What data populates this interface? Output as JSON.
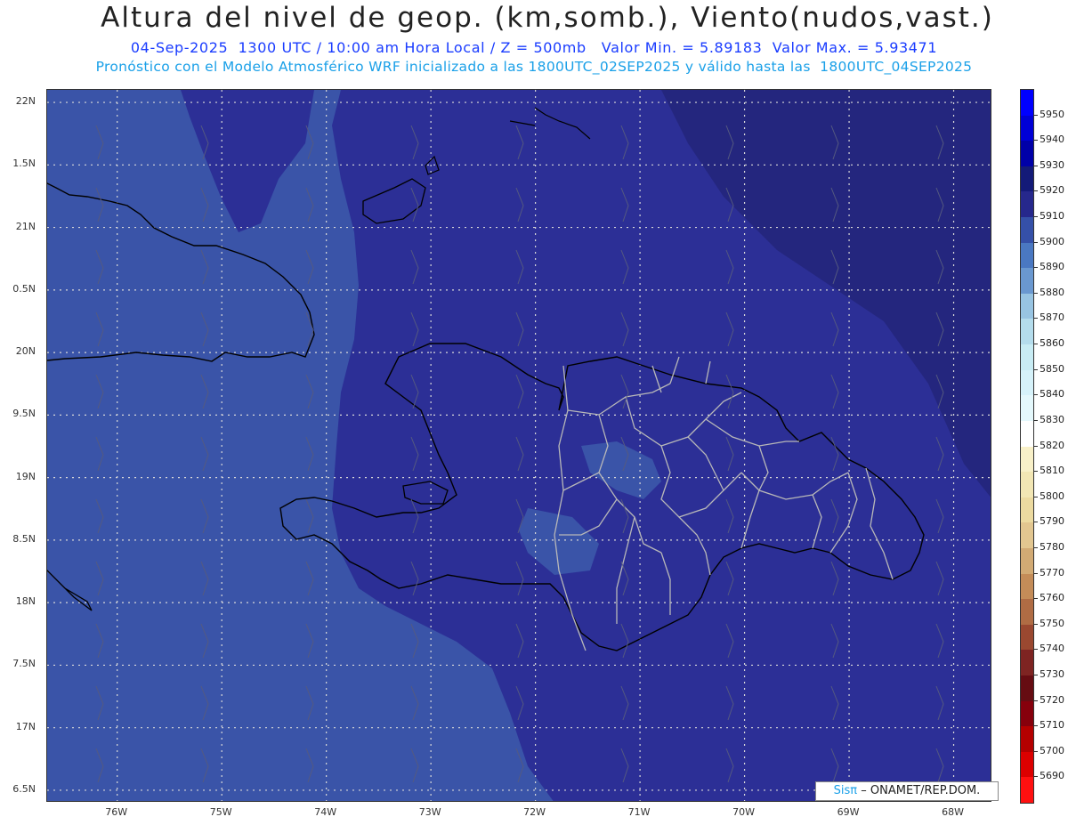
{
  "header": {
    "title": "Altura del nivel de geop. (km,somb.), Viento(nudos,vast.)",
    "subtitle1": "04-Sep-2025  1300 UTC / 10:00 am Hora Local / Z = 500mb   Valor Min. = 5.89183  Valor Max. = 5.93471",
    "subtitle2": "Pronóstico con el Modelo Atmosférico WRF inicializado a las 1800UTC_02SEP2025 y válido hasta las  1800UTC_04SEP2025"
  },
  "map": {
    "lon_range": [
      -76.67,
      -67.63
    ],
    "lat_range": [
      16.4,
      22.1
    ],
    "lat_labels": [
      "22N",
      "1.5N",
      "21N",
      "0.5N",
      "20N",
      "9.5N",
      "19N",
      "8.5N",
      "18N",
      "7.5N",
      "17N",
      "6.5N"
    ],
    "lat_values": [
      22,
      21.5,
      21,
      20.5,
      20,
      19.5,
      19,
      18.5,
      18,
      17.5,
      17,
      16.5
    ],
    "lon_labels": [
      "76W",
      "75W",
      "74W",
      "73W",
      "72W",
      "71W",
      "70W",
      "69W",
      "68W"
    ],
    "lon_values": [
      -76,
      -75,
      -74,
      -73,
      -72,
      -71,
      -70,
      -69,
      -68
    ],
    "colors": {
      "lower": "#3a54a8",
      "mid": "#2c2f96",
      "upper": "#24267e",
      "coast": "#000000",
      "provinces": "#b8b8b8",
      "grid": "#d8d8d8"
    }
  },
  "credit": {
    "sis": "Sisπ",
    "rest": "– ONAMET/REP.DOM."
  },
  "colorbar": {
    "labels": [
      "5950",
      "5940",
      "5930",
      "5920",
      "5910",
      "5900",
      "5890",
      "5880",
      "5870",
      "5860",
      "5850",
      "5840",
      "5830",
      "5820",
      "5810",
      "5800",
      "5790",
      "5780",
      "5770",
      "5760",
      "5750",
      "5740",
      "5730",
      "5720",
      "5710",
      "5700",
      "5690"
    ],
    "colors": [
      "#0000ff",
      "#0000d6",
      "#0000a8",
      "#141a78",
      "#26288c",
      "#3550a8",
      "#4a78c2",
      "#6a98d0",
      "#98c4e2",
      "#b4dcec",
      "#c8ecf4",
      "#d6f2fa",
      "#e4f8fc",
      "#ffffff",
      "#f8f0c8",
      "#f2e6b4",
      "#ecdaa0",
      "#e2c690",
      "#d2aa74",
      "#c48c58",
      "#b06c44",
      "#9a4830",
      "#7e2422",
      "#660c12",
      "#86000c",
      "#b40000",
      "#dc0000",
      "#ff1010"
    ]
  }
}
